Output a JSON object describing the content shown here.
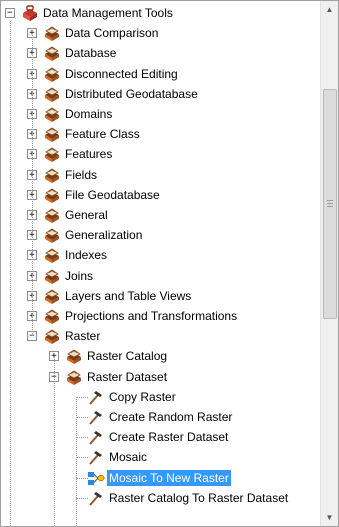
{
  "tree": {
    "root": {
      "label": "Data Management Tools",
      "icon": "red-toolbox-icon",
      "expanded": true
    },
    "categories": [
      {
        "label": "Data Comparison"
      },
      {
        "label": "Database"
      },
      {
        "label": "Disconnected Editing"
      },
      {
        "label": "Distributed Geodatabase"
      },
      {
        "label": "Domains"
      },
      {
        "label": "Feature Class"
      },
      {
        "label": "Features"
      },
      {
        "label": "Fields"
      },
      {
        "label": "File Geodatabase"
      },
      {
        "label": "General"
      },
      {
        "label": "Generalization"
      },
      {
        "label": "Indexes"
      },
      {
        "label": "Joins"
      },
      {
        "label": "Layers and Table Views"
      },
      {
        "label": "Projections and Transformations"
      }
    ],
    "raster": {
      "label": "Raster",
      "children": {
        "raster_catalog": {
          "label": "Raster Catalog"
        },
        "raster_dataset": {
          "label": "Raster Dataset",
          "tools": [
            {
              "label": "Copy Raster",
              "icon": "hammer-tool-icon"
            },
            {
              "label": "Create Random Raster",
              "icon": "hammer-tool-icon"
            },
            {
              "label": "Create Raster Dataset",
              "icon": "hammer-tool-icon"
            },
            {
              "label": "Mosaic",
              "icon": "hammer-tool-icon"
            },
            {
              "label": "Mosaic To New Raster",
              "icon": "model-tool-icon",
              "selected": true
            },
            {
              "label": "Raster Catalog To Raster Dataset",
              "icon": "hammer-tool-icon"
            }
          ]
        }
      }
    },
    "symbols": {
      "plus": "+",
      "minus": "−"
    }
  },
  "scrollbar": {
    "up_glyph": "▲",
    "down_glyph": "▼"
  },
  "colors": {
    "selection": "#3399ff",
    "toolset_icon": "#c0392b"
  }
}
